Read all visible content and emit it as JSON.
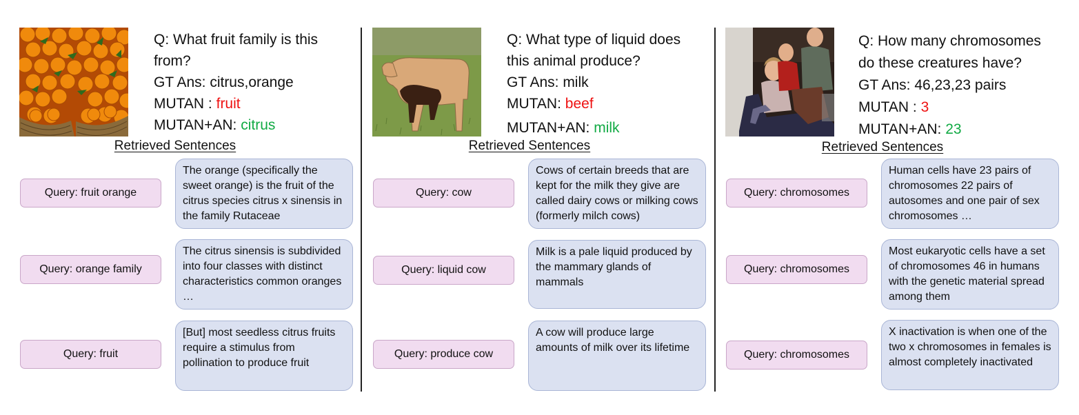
{
  "retrieved_title": "Retrieved Sentences",
  "panels": [
    {
      "question": "Q: What fruit family is this from?",
      "question_lines": [
        "Q: What fruit family is this",
        "from?"
      ],
      "gt_answer": "GT Ans: citrus,orange",
      "mutan_label": "MUTAN : ",
      "mutan_answer": "fruit",
      "mutan_an_label": "MUTAN+AN: ",
      "mutan_an_answer": "citrus",
      "rows": [
        {
          "query": "Query: fruit orange",
          "sentence": "The orange (specifically the sweet orange) is the fruit of the citrus species citrus x sinensis in the family Rutaceae"
        },
        {
          "query": "Query: orange family",
          "sentence": "The citrus sinensis is subdivided into four classes with distinct characteristics common oranges …"
        },
        {
          "query": "Query: fruit",
          "sentence": "[But] most seedless citrus fruits require a stimulus from pollination to produce fruit"
        }
      ]
    },
    {
      "question": "Q: What type of liquid does this animal produce?",
      "question_lines": [
        "Q: What type of liquid does",
        "this animal produce?"
      ],
      "gt_answer": "GT Ans: milk",
      "mutan_label": "MUTAN: ",
      "mutan_answer": "beef",
      "mutan_an_label": "MUTAN+AN: ",
      "mutan_an_answer": "milk",
      "rows": [
        {
          "query": "Query: cow",
          "sentence": "Cows of certain breeds that are kept for the milk they give are called dairy cows or milking cows (formerly milch cows)"
        },
        {
          "query": "Query: liquid cow",
          "sentence": "Milk is a pale liquid produced by the mammary glands of mammals"
        },
        {
          "query": "Query: produce cow",
          "sentence": "A cow will produce large amounts of milk over its lifetime"
        }
      ]
    },
    {
      "question": "Q: How many chromosomes do these creatures have?",
      "question_lines": [
        "Q: How many chromosomes",
        "do these creatures have?"
      ],
      "gt_answer": "GT Ans: 46,23,23 pairs",
      "mutan_label": "MUTAN : ",
      "mutan_answer": "3",
      "mutan_an_label": "MUTAN+AN: ",
      "mutan_an_answer": "23",
      "rows": [
        {
          "query": "Query: chromosomes",
          "sentence": "Human cells have 23 pairs of chromosomes 22 pairs of autosomes and one pair of sex chromosomes …"
        },
        {
          "query": "Query: chromosomes",
          "sentence": "Most eukaryotic cells have a set of chromosomes 46 in humans with the genetic material spread among them"
        },
        {
          "query": "Query: chromosomes",
          "sentence": "X inactivation is when one of the two x chromosomes in females is almost completely inactivated"
        }
      ]
    }
  ]
}
